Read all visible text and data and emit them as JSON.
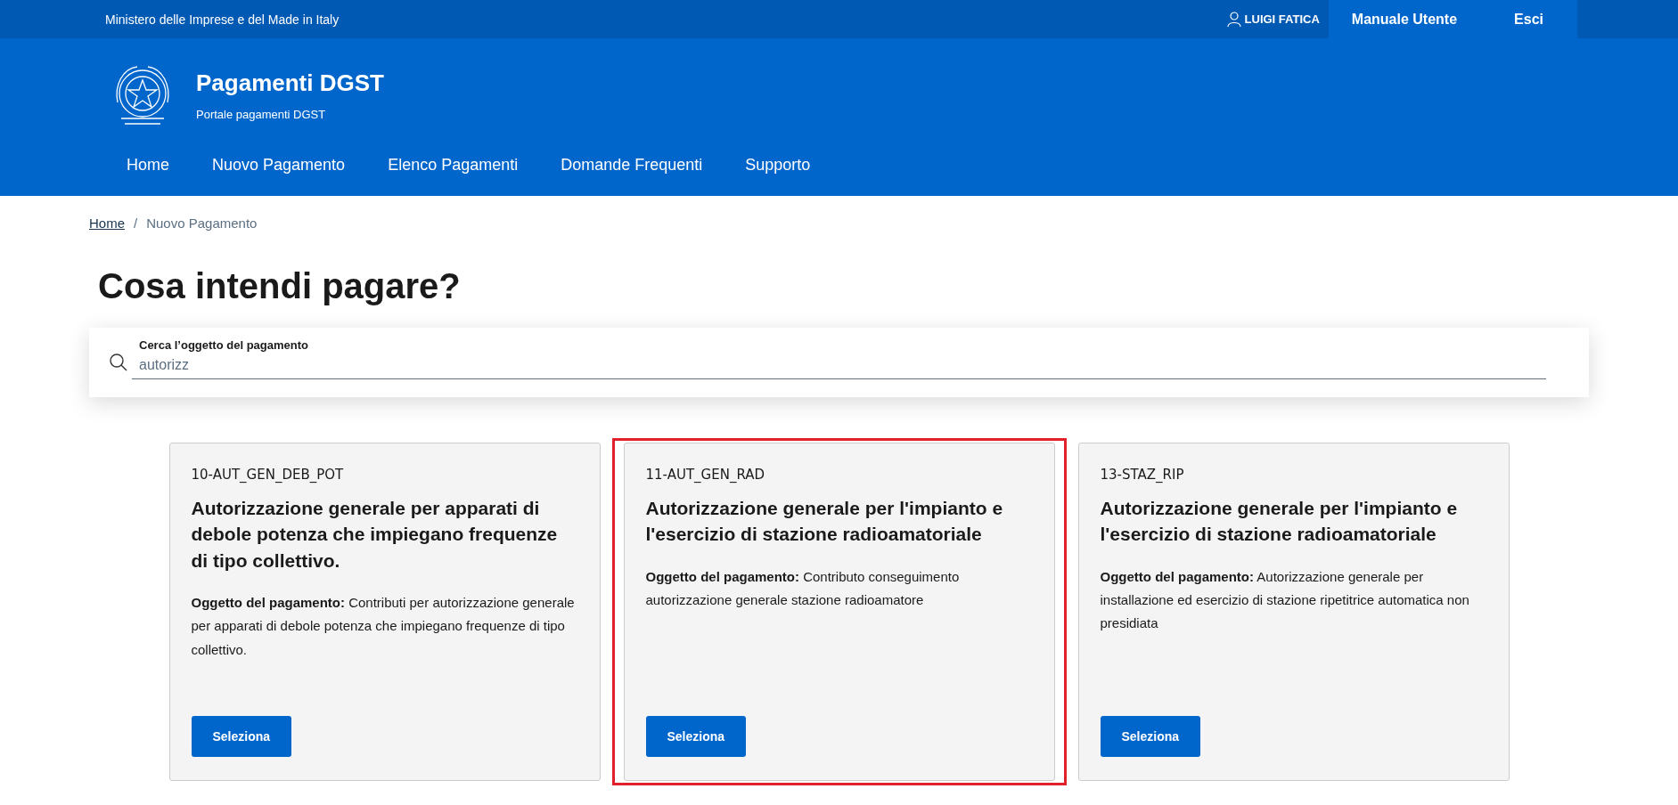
{
  "top_bar": {
    "ministry": "Ministero delle Imprese e del Made in Italy",
    "user": "LUIGI FATICA",
    "links": [
      {
        "label": "Manuale Utente"
      },
      {
        "label": "Esci"
      }
    ]
  },
  "header": {
    "title": "Pagamenti DGST",
    "subtitle": "Portale pagamenti DGST"
  },
  "nav": [
    {
      "label": "Home"
    },
    {
      "label": "Nuovo Pagamento"
    },
    {
      "label": "Elenco Pagamenti"
    },
    {
      "label": "Domande Frequenti"
    },
    {
      "label": "Supporto"
    }
  ],
  "breadcrumb_separator": "/",
  "breadcrumb": [
    {
      "label": "Home",
      "kind": "link"
    },
    {
      "label": "Nuovo Pagamento",
      "kind": "current"
    }
  ],
  "page_title": "Cosa intendi pagare?",
  "search": {
    "label": "Cerca l’oggetto del pagamento",
    "value": "autorizz"
  },
  "cards": [
    {
      "code": "10-AUT_GEN_DEB_POT",
      "title": "Autorizzazione generale per apparati di debole potenza che impiegano frequenze di tipo collettivo.",
      "description": "**Oggetto del pagamento:** Contributi per autorizzazione generale per apparati di debole potenza che impiegano frequenze di tipo collettivo.",
      "button": "Seleziona",
      "highlighted": false
    },
    {
      "code": "11-AUT_GEN_RAD",
      "title": "Autorizzazione generale per l'impianto e l'esercizio di stazione radioamatoriale",
      "description": "**Oggetto del pagamento:** Contributo conseguimento autorizzazione generale stazione radioamatore",
      "button": "Seleziona",
      "highlighted": true
    },
    {
      "code": "13-STAZ_RIP",
      "title": "Autorizzazione generale per l'impianto e l'esercizio di stazione radioamatoriale",
      "description": "**Oggetto del pagamento:** Autorizzazione generale per installazione ed esercizio di stazione ripetitrice automatica non presidiata",
      "button": "Seleziona",
      "highlighted": false
    }
  ]
}
